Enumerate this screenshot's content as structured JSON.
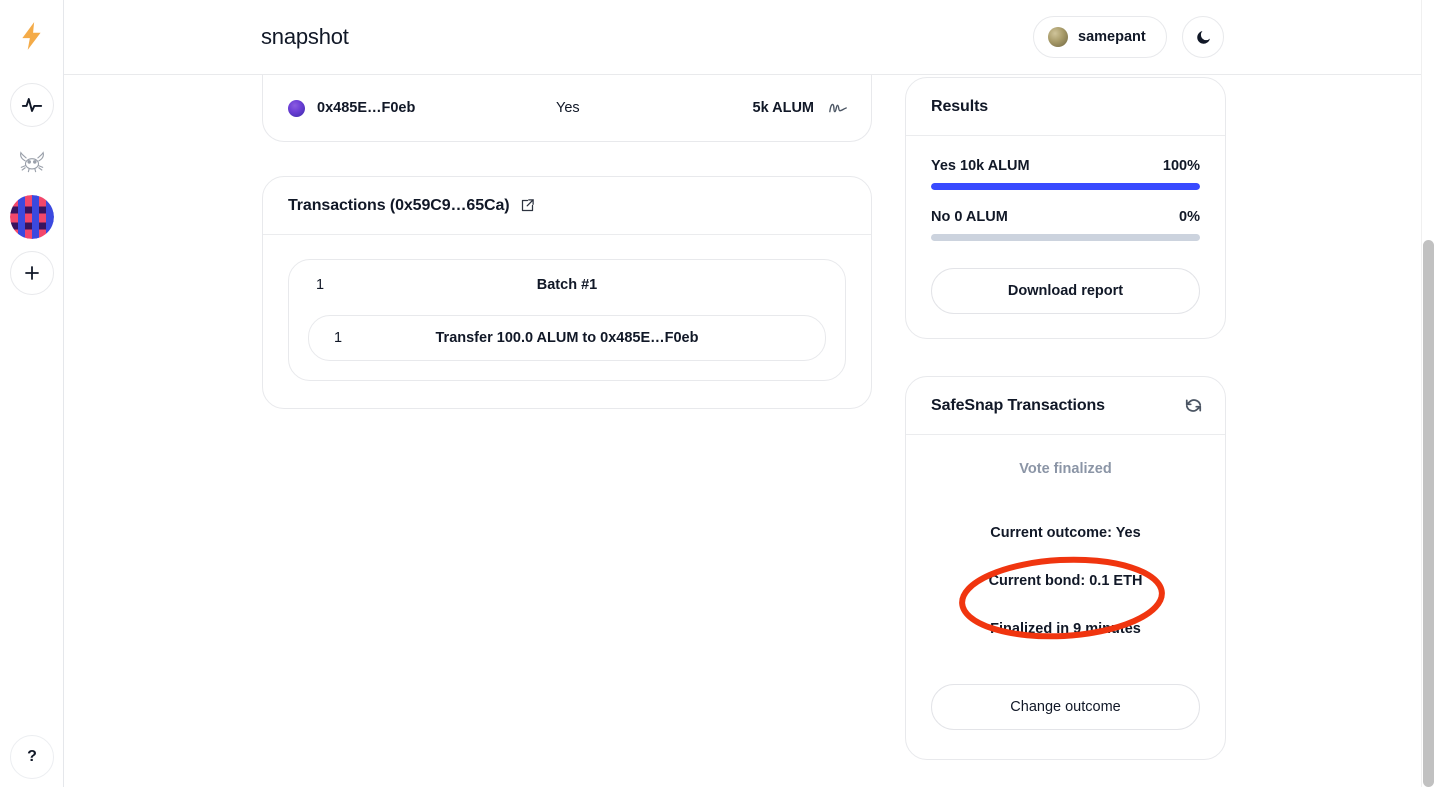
{
  "app": {
    "title": "snapshot",
    "logo_icon": "lightning-bolt-icon"
  },
  "rail": {
    "items": [
      {
        "name": "activity-pulse",
        "icon": "pulse-icon",
        "label": ""
      },
      {
        "name": "crab-space",
        "icon": "crab-icon",
        "label": ""
      },
      {
        "name": "alum-space",
        "icon": "blockie-avatar",
        "label": ""
      },
      {
        "name": "create-space",
        "icon": "plus-icon",
        "label": "+"
      }
    ],
    "help_label": "?"
  },
  "header": {
    "user_name": "samepant",
    "theme_icon": "moon-icon",
    "avatar_icon": "user-avatar"
  },
  "vote_row": {
    "voter": "0x485E…F0eb",
    "choice": "Yes",
    "voting_power": "5k ALUM",
    "signature_icon": "signature-icon"
  },
  "transactions": {
    "title": "Transactions (0x59C9…65Ca)",
    "external_link_icon": "external-link-icon",
    "batch": {
      "index": "1",
      "title": "Batch #1",
      "items": [
        {
          "index": "1",
          "label": "Transfer 100.0 ALUM to 0x485E…F0eb"
        }
      ]
    }
  },
  "results": {
    "title": "Results",
    "rows": [
      {
        "label": "Yes 10k ALUM",
        "percent_label": "100%",
        "percent": 100,
        "color": "#384aff"
      },
      {
        "label": "No 0 ALUM",
        "percent_label": "0%",
        "percent": 0,
        "color": "#ccd3de"
      }
    ],
    "download_label": "Download report"
  },
  "safesnap": {
    "title": "SafeSnap Transactions",
    "refresh_icon": "refresh-icon",
    "status": "Vote finalized",
    "outcome_line": "Current outcome: Yes",
    "bond_line": "Current bond: 0.1 ETH",
    "finalized_line": "Finalized in 9 minutes",
    "change_outcome_label": "Change outcome"
  },
  "annotation": {
    "color": "#f0350f",
    "shape": "ellipse",
    "target": "Finalized in 9 minutes"
  }
}
